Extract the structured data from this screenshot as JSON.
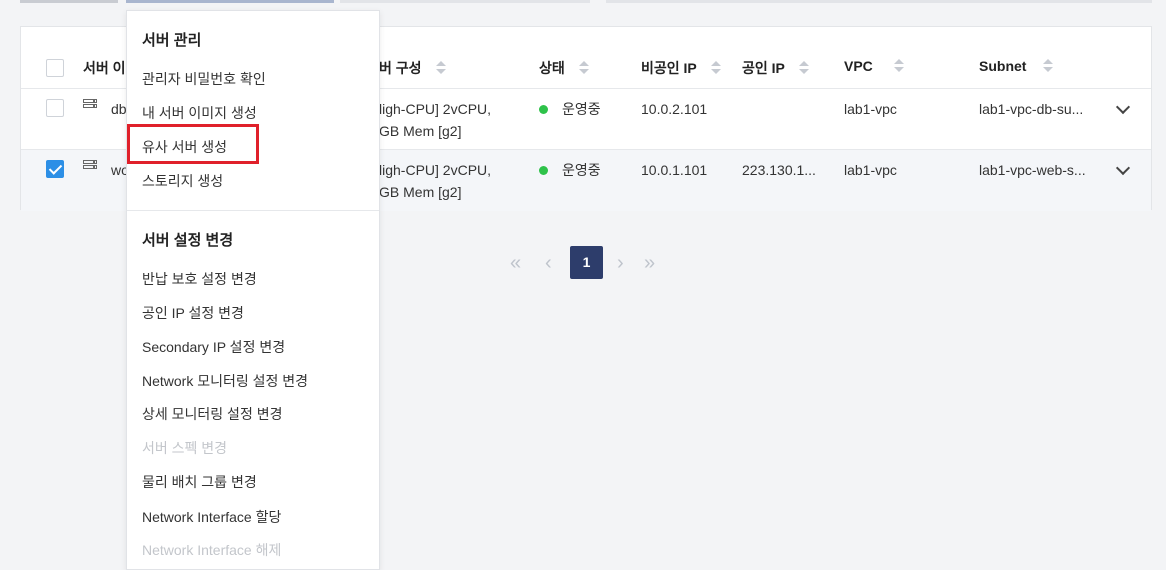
{
  "table": {
    "columns": {
      "server_name": "서버 이",
      "server_spec": "버 구성",
      "status": "상태",
      "private_ip": "비공인 IP",
      "public_ip": "공인 IP",
      "vpc": "VPC",
      "subnet": "Subnet"
    },
    "rows": [
      {
        "checked": false,
        "name": "db",
        "spec_line1": "ligh-CPU] 2vCPU,",
        "spec_line2": "GB Mem [g2]",
        "status": "운영중",
        "private_ip": "10.0.2.101",
        "public_ip": "",
        "vpc": "lab1-vpc",
        "subnet": "lab1-vpc-db-su..."
      },
      {
        "checked": true,
        "name": "wo",
        "spec_line1": "ligh-CPU] 2vCPU,",
        "spec_line2": "GB Mem [g2]",
        "status": "운영중",
        "private_ip": "10.0.1.101",
        "public_ip": "223.130.1...",
        "vpc": "lab1-vpc",
        "subnet": "lab1-vpc-web-s..."
      }
    ]
  },
  "pagination": {
    "first": "«",
    "prev": "‹",
    "current": "1",
    "next": "›",
    "last": "»"
  },
  "menu": {
    "section1_title": "서버 관리",
    "section1_items": [
      "관리자 비밀번호 확인",
      "내 서버 이미지 생성",
      "유사 서버 생성",
      "스토리지 생성"
    ],
    "section2_title": "서버 설정 변경",
    "section2_items": [
      "반납 보호 설정 변경",
      "공인 IP 설정 변경",
      "Secondary IP 설정 변경",
      "Network 모니터링 설정 변경",
      "상세 모니터링 설정 변경",
      "서버 스펙 변경",
      "물리 배치 그룹 변경",
      "Network Interface 할당",
      "Network Interface 해제"
    ],
    "disabled_items": [
      "서버 스펙 변경",
      "Network Interface 해제"
    ],
    "highlighted_item": "유사 서버 생성"
  },
  "colors": {
    "status_running": "#2ec24a",
    "highlight_border": "#e0202a",
    "checkbox_checked": "#2c8fe6",
    "pager_active": "#2d3d6b"
  }
}
